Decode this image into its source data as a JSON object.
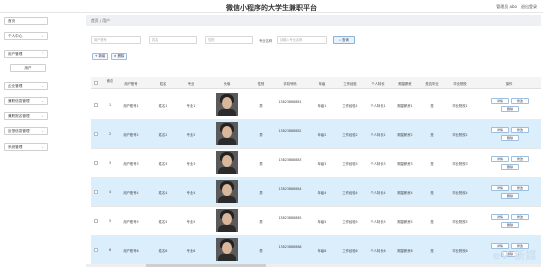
{
  "header": {
    "title": "微信小程序的大学生兼职平台",
    "user_label": "管理员 abo",
    "logout_label": "退出登录"
  },
  "sidebar": {
    "items": [
      {
        "label": "首页",
        "has_chevron": false
      },
      {
        "label": "个人中心",
        "has_chevron": true
      },
      {
        "label": "用户管理",
        "has_chevron": true
      },
      {
        "label": "用户",
        "has_chevron": false
      },
      {
        "label": "企业管理",
        "has_chevron": true
      },
      {
        "label": "兼职信息管理",
        "has_chevron": true
      },
      {
        "label": "兼职报名管理",
        "has_chevron": true
      },
      {
        "label": "反馈信息管理",
        "has_chevron": true
      },
      {
        "label": "系统管理",
        "has_chevron": true
      }
    ]
  },
  "breadcrumb": "首页 / 用户",
  "search": {
    "f1_placeholder": "用户账号",
    "f2_placeholder": "姓名",
    "f3_placeholder": "性别",
    "f4_label": "专业名称",
    "f4_placeholder": "请输入专业名称",
    "button": "查询"
  },
  "actions": {
    "add": "新增",
    "delete": "删除"
  },
  "table": {
    "headers": [
      "",
      "索引",
      "用户账号",
      "姓名",
      "专业",
      "头像",
      "性别",
      "手机号码",
      "年级",
      "工作经验",
      "个人特长",
      "期望薪资",
      "是否毕业",
      "毕业院校",
      "操作"
    ],
    "rows": [
      {
        "index": "1",
        "account": "用户账号1",
        "name": "姓名1",
        "major": "专业1",
        "gender": "男",
        "phone": "13823888881",
        "grade": "年级1",
        "exp": "工作经验1",
        "skill": "个人特长1",
        "salary": "期望薪资1",
        "graduated": "是",
        "school": "毕业院校1"
      },
      {
        "index": "2",
        "account": "用户账号2",
        "name": "姓名2",
        "major": "专业2",
        "gender": "男",
        "phone": "13823888882",
        "grade": "年级2",
        "exp": "工作经验2",
        "skill": "个人特长2",
        "salary": "期望薪资2",
        "graduated": "是",
        "school": "毕业院校2"
      },
      {
        "index": "3",
        "account": "用户账号3",
        "name": "姓名3",
        "major": "专业3",
        "gender": "男",
        "phone": "13823888883",
        "grade": "年级3",
        "exp": "工作经验3",
        "skill": "个人特长3",
        "salary": "期望薪资3",
        "graduated": "是",
        "school": "毕业院校3"
      },
      {
        "index": "4",
        "account": "用户账号4",
        "name": "姓名4",
        "major": "专业4",
        "gender": "男",
        "phone": "13823888884",
        "grade": "年级4",
        "exp": "工作经验4",
        "skill": "个人特长4",
        "salary": "期望薪资4",
        "graduated": "是",
        "school": "毕业院校4"
      },
      {
        "index": "5",
        "account": "用户账号5",
        "name": "姓名5",
        "major": "专业5",
        "gender": "男",
        "phone": "13823888885",
        "grade": "年级5",
        "exp": "工作经验5",
        "skill": "个人特长5",
        "salary": "期望薪资5",
        "graduated": "是",
        "school": "毕业院校5"
      },
      {
        "index": "6",
        "account": "用户账号6",
        "name": "姓名6",
        "major": "专业6",
        "gender": "男",
        "phone": "13823888886",
        "grade": "年级6",
        "exp": "工作经验6",
        "skill": "个人特长6",
        "salary": "期望薪资6",
        "graduated": "是",
        "school": "毕业院校6"
      }
    ],
    "op_detail": "详情",
    "op_edit": "修改",
    "op_delete": "删除"
  },
  "watermark": "eV 新媒"
}
